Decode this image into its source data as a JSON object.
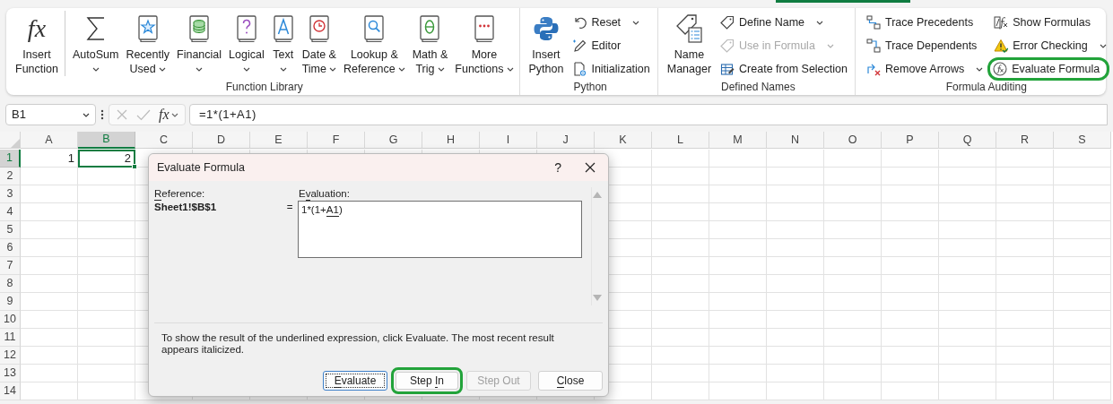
{
  "ribbon": {
    "groups": [
      {
        "label": "Function Library",
        "items": [
          {
            "kind": "large",
            "icon_text": "fx",
            "lines": [
              "Insert",
              "Function"
            ],
            "dropdown": false,
            "separator_after": true
          },
          {
            "kind": "large",
            "lines": [
              "AutoSum"
            ],
            "dropdown": true,
            "separator_after": false
          },
          {
            "kind": "large",
            "lines": [
              "Recently",
              "Used"
            ],
            "dropdown": true,
            "separator_after": false
          },
          {
            "kind": "large",
            "lines": [
              "Financial"
            ],
            "dropdown": true,
            "separator_after": false
          },
          {
            "kind": "large",
            "lines": [
              "Logical"
            ],
            "dropdown": true,
            "separator_after": false
          },
          {
            "kind": "large",
            "lines": [
              "Text"
            ],
            "dropdown": true,
            "separator_after": false
          },
          {
            "kind": "large",
            "lines": [
              "Date &",
              "Time"
            ],
            "dropdown": true,
            "separator_after": false
          },
          {
            "kind": "large",
            "lines": [
              "Lookup &",
              "Reference"
            ],
            "dropdown": true,
            "separator_after": false
          },
          {
            "kind": "large",
            "lines": [
              "Math &",
              "Trig"
            ],
            "dropdown": true,
            "separator_after": false
          },
          {
            "kind": "large",
            "lines": [
              "More",
              "Functions"
            ],
            "dropdown": true,
            "separator_after": false
          }
        ]
      },
      {
        "label": "Python",
        "items": [
          {
            "kind": "large",
            "lines": [
              "Insert",
              "Python"
            ],
            "dropdown": false,
            "separator_after": false
          },
          {
            "kind": "stack",
            "items": [
              {
                "label": "Reset",
                "dropdown": true,
                "disabled": false,
                "highlighted": false
              },
              {
                "label": "Editor",
                "dropdown": false,
                "disabled": false,
                "highlighted": false
              },
              {
                "label": "Initialization",
                "dropdown": false,
                "disabled": false,
                "highlighted": false
              }
            ]
          }
        ]
      },
      {
        "label": "Defined Names",
        "items": [
          {
            "kind": "large",
            "lines": [
              "Name",
              "Manager"
            ],
            "dropdown": false,
            "separator_after": false
          },
          {
            "kind": "stack",
            "items": [
              {
                "label": "Define Name",
                "dropdown": true,
                "disabled": false,
                "highlighted": false
              },
              {
                "label": "Use in Formula",
                "dropdown": true,
                "disabled": true,
                "highlighted": false
              },
              {
                "label": "Create from Selection",
                "dropdown": false,
                "disabled": false,
                "highlighted": false
              }
            ]
          }
        ]
      },
      {
        "label": "Formula Auditing",
        "items": [
          {
            "kind": "stack",
            "items": [
              {
                "label": "Trace Precedents",
                "dropdown": false,
                "disabled": false,
                "highlighted": false
              },
              {
                "label": "Trace Dependents",
                "dropdown": false,
                "disabled": false,
                "highlighted": false
              },
              {
                "label": "Remove Arrows",
                "dropdown": true,
                "disabled": false,
                "highlighted": false
              }
            ]
          },
          {
            "kind": "stack",
            "items": [
              {
                "label": "Show Formulas",
                "dropdown": false,
                "disabled": false,
                "highlighted": false
              },
              {
                "label": "Error Checking",
                "dropdown": true,
                "disabled": false,
                "highlighted": false
              },
              {
                "label": "Evaluate Formula",
                "dropdown": false,
                "disabled": false,
                "highlighted": true
              }
            ]
          }
        ]
      }
    ]
  },
  "formula_bar": {
    "name_box": "B1",
    "fx": "fx",
    "formula": "=1*(1+A1)"
  },
  "sheet": {
    "columns": [
      {
        "label": "A",
        "selected": false
      },
      {
        "label": "B",
        "selected": true
      },
      {
        "label": "C",
        "selected": false
      },
      {
        "label": "D",
        "selected": false
      },
      {
        "label": "E",
        "selected": false
      },
      {
        "label": "F",
        "selected": false
      },
      {
        "label": "G",
        "selected": false
      },
      {
        "label": "H",
        "selected": false
      },
      {
        "label": "I",
        "selected": false
      },
      {
        "label": "J",
        "selected": false
      },
      {
        "label": "K",
        "selected": false
      },
      {
        "label": "L",
        "selected": false
      },
      {
        "label": "M",
        "selected": false
      },
      {
        "label": "N",
        "selected": false
      },
      {
        "label": "O",
        "selected": false
      },
      {
        "label": "P",
        "selected": false
      },
      {
        "label": "Q",
        "selected": false
      },
      {
        "label": "R",
        "selected": false
      },
      {
        "label": "S",
        "selected": false
      }
    ],
    "rows": [
      {
        "label": "1",
        "selected": true,
        "cells": [
          {
            "value": "1",
            "selected": false
          },
          {
            "value": "2",
            "selected": true
          }
        ]
      },
      {
        "label": "2",
        "selected": false
      },
      {
        "label": "3",
        "selected": false
      },
      {
        "label": "4",
        "selected": false
      },
      {
        "label": "5",
        "selected": false
      },
      {
        "label": "6",
        "selected": false
      },
      {
        "label": "7",
        "selected": false
      },
      {
        "label": "8",
        "selected": false
      },
      {
        "label": "9",
        "selected": false
      },
      {
        "label": "10",
        "selected": false
      },
      {
        "label": "11",
        "selected": false
      },
      {
        "label": "12",
        "selected": false
      },
      {
        "label": "13",
        "selected": false
      },
      {
        "label": "14",
        "selected": false
      }
    ]
  },
  "dialog": {
    "title": "Evaluate Formula",
    "help": "?",
    "reference_label": [
      {
        "text": "R",
        "underlined": true
      },
      {
        "text": "eference:",
        "underlined": false
      }
    ],
    "reference": "Sheet1!$B$1",
    "equals": "=",
    "evaluation_label": [
      {
        "text": "E",
        "underlined": false
      },
      {
        "text": "v",
        "underlined": true
      },
      {
        "text": "aluation:",
        "underlined": false
      }
    ],
    "expression": [
      {
        "text": "1*(1+",
        "underlined": false
      },
      {
        "text": "A1",
        "underlined": true
      },
      {
        "text": ")",
        "underlined": false
      }
    ],
    "message": "To show the result of the underlined expression, click Evaluate.  The most recent result appears italicized.",
    "buttons": [
      {
        "label": [
          {
            "text": "E",
            "underlined": true
          },
          {
            "text": "valuate",
            "underlined": false
          }
        ],
        "disabled": false,
        "focused": true,
        "highlighted": false
      },
      {
        "label": [
          {
            "text": "Step ",
            "underlined": false
          },
          {
            "text": "I",
            "underlined": true
          },
          {
            "text": "n",
            "underlined": false
          }
        ],
        "disabled": false,
        "focused": false,
        "highlighted": true
      },
      {
        "label": [
          {
            "text": "Step Out",
            "underlined": false
          }
        ],
        "disabled": true,
        "focused": false,
        "highlighted": false
      },
      {
        "label": [
          {
            "text": "C",
            "underlined": true
          },
          {
            "text": "lose",
            "underlined": false
          }
        ],
        "disabled": false,
        "focused": false,
        "highlighted": false
      }
    ]
  }
}
